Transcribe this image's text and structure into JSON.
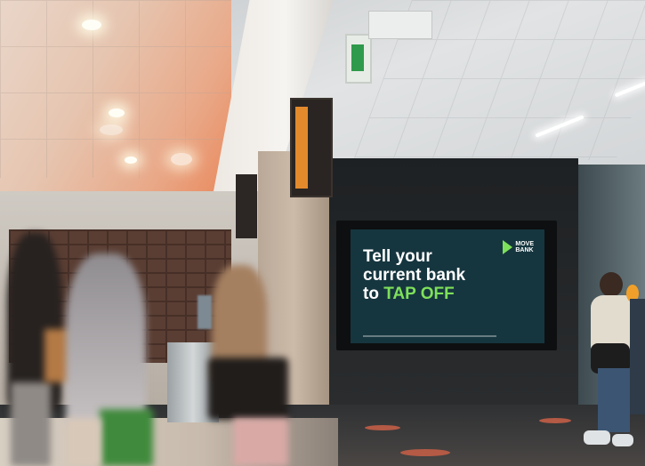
{
  "billboard": {
    "headline_line1": "Tell your",
    "headline_line2": "current bank",
    "headline_line3_prefix": "to ",
    "headline_accent": "TAP OFF",
    "logo_line1": "MOVE",
    "logo_line2": "BANK",
    "colors": {
      "background": "#16363f",
      "accent": "#7ee05a",
      "text": "#ffffff"
    }
  },
  "scene": {
    "signs": [
      "exit-sign",
      "orange-wayfinding-sign"
    ]
  }
}
